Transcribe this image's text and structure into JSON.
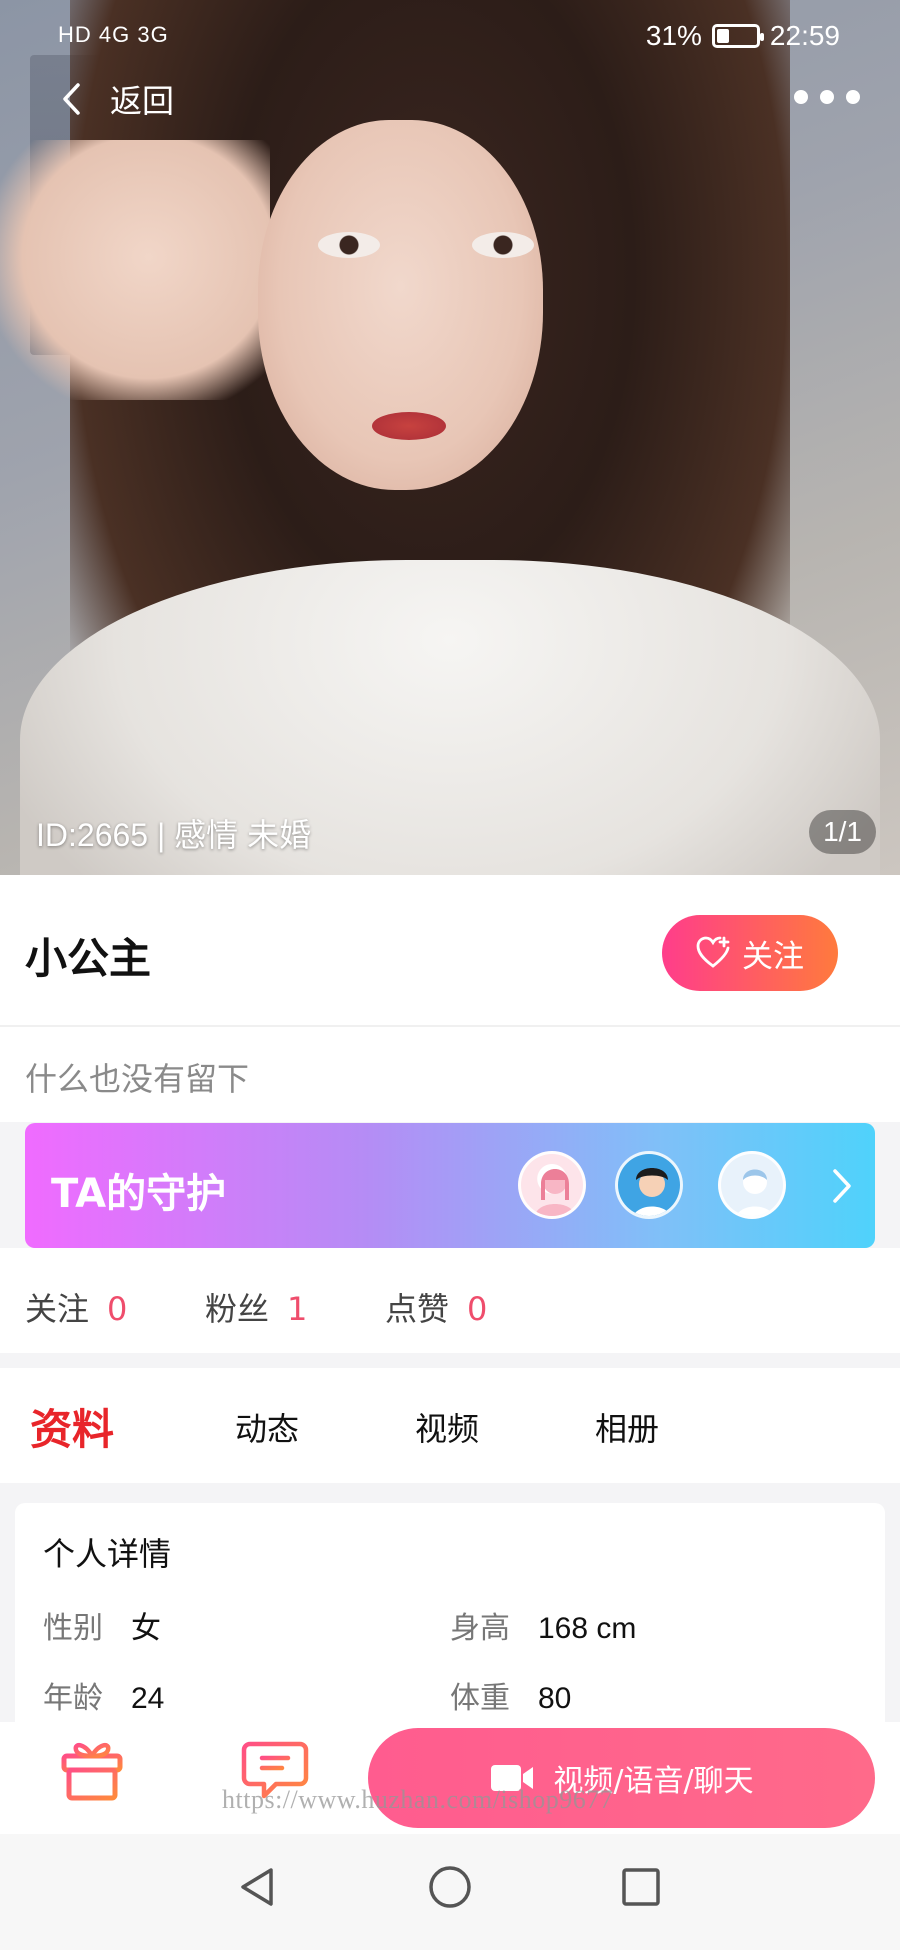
{
  "status_bar": {
    "network": "HD 4G 3G",
    "battery_percent": "31%",
    "battery_level": 0.31,
    "time": "22:59"
  },
  "nav": {
    "back_label": "返回"
  },
  "hero": {
    "id_text": "ID:2665 | 感情 未婚",
    "photo_counter": "1/1"
  },
  "profile": {
    "nickname": "小公主",
    "follow_label": "关注",
    "bio": "什么也没有留下"
  },
  "guard": {
    "title": "TA的守护",
    "avatar_count": 3
  },
  "stats": [
    {
      "label": "关注",
      "value": "0"
    },
    {
      "label": "粉丝",
      "value": "1"
    },
    {
      "label": "点赞",
      "value": "0"
    }
  ],
  "tabs": [
    {
      "label": "资料",
      "active": true
    },
    {
      "label": "动态",
      "active": false
    },
    {
      "label": "视频",
      "active": false
    },
    {
      "label": "相册",
      "active": false
    }
  ],
  "details": {
    "title": "个人详情",
    "fields": [
      {
        "key": "性别",
        "value": "女"
      },
      {
        "key": "身高",
        "value": "168 cm"
      },
      {
        "key": "年龄",
        "value": "24"
      },
      {
        "key": "体重",
        "value": "80"
      }
    ]
  },
  "actions": {
    "call_label": "视频/语音/聊天",
    "watermark": "https://www.huzhan.com/ishop9677"
  },
  "colors": {
    "accent_red": "#e8252a",
    "stat_number": "#ef4d6c",
    "follow_gradient": [
      "#ff3d8b",
      "#ff7a3d"
    ],
    "call_button": "#ff5c8f"
  }
}
